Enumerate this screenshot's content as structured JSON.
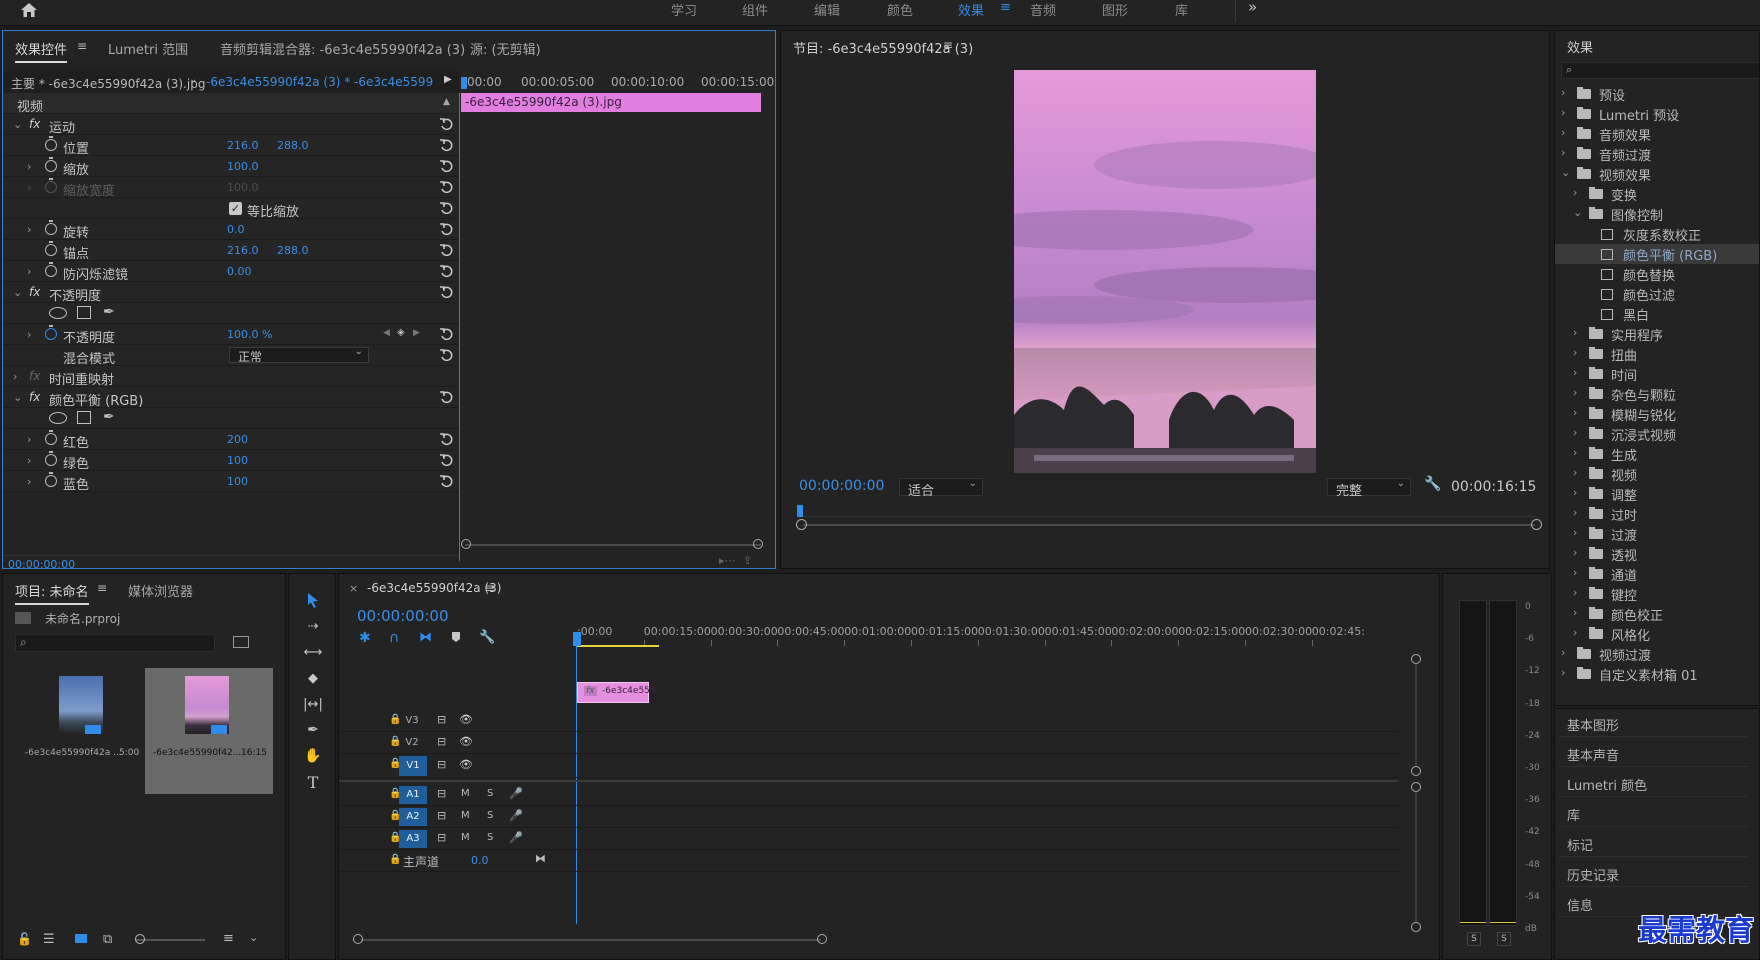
{
  "workspace_tabs": [
    "学习",
    "组件",
    "编辑",
    "颜色",
    "效果",
    "音频",
    "图形",
    "库"
  ],
  "workspace_active": "效果",
  "effect_controls": {
    "tabs": [
      "效果控件",
      "Lumetri 范围",
      "音频剪辑混合器: -6e3c4e55990f42a (3)",
      "源: (无剪辑)"
    ],
    "clip_master": "主要 * -6e3c4e55990f42a (3).jpg",
    "clip_sequence": "-6e3c4e55990f42a (3) * -6e3c4e55990f42a ...",
    "section_video": "视频",
    "mini_timecodes": [
      ":00:00",
      "00:00:05:00",
      "00:00:10:00",
      "00:00:15:00"
    ],
    "mini_clip": "-6e3c4e55990f42a (3).jpg",
    "motion": "运动",
    "position": {
      "label": "位置",
      "x": "216.0",
      "y": "288.0"
    },
    "scale": {
      "label": "缩放",
      "value": "100.0"
    },
    "scale_width": {
      "label": "缩放宽度",
      "value": "100.0"
    },
    "uniform_scale": "等比缩放",
    "rotation": {
      "label": "旋转",
      "value": "0.0"
    },
    "anchor": {
      "label": "锚点",
      "x": "216.0",
      "y": "288.0"
    },
    "antiflicker": {
      "label": "防闪烁滤镜",
      "value": "0.00"
    },
    "opacity_section": "不透明度",
    "opacity": {
      "label": "不透明度",
      "value": "100.0 %"
    },
    "blend_mode": {
      "label": "混合模式",
      "value": "正常"
    },
    "time_remap": "时间重映射",
    "color_balance": "颜色平衡 (RGB)",
    "red": {
      "label": "红色",
      "value": "200"
    },
    "green": {
      "label": "绿色",
      "value": "100"
    },
    "blue": {
      "label": "蓝色",
      "value": "100"
    },
    "timecode": "00:00:00:00"
  },
  "program": {
    "title": "节目: -6e3c4e55990f42a (3)",
    "timecode": "00:00:00:00",
    "fit": "适合",
    "quality": "完整",
    "duration": "00:00:16:15"
  },
  "effects_panel": {
    "title": "效果",
    "items": [
      {
        "label": "预设",
        "level": 0,
        "icon": "star-folder"
      },
      {
        "label": "Lumetri 预设",
        "level": 0,
        "icon": "star-folder"
      },
      {
        "label": "音频效果",
        "level": 0,
        "icon": "folder"
      },
      {
        "label": "音频过渡",
        "level": 0,
        "icon": "folder"
      },
      {
        "label": "视频效果",
        "level": 0,
        "icon": "folder",
        "open": true
      },
      {
        "label": "变换",
        "level": 1,
        "icon": "folder"
      },
      {
        "label": "图像控制",
        "level": 1,
        "icon": "folder",
        "open": true
      },
      {
        "label": "灰度系数校正",
        "level": 2,
        "icon": "effect"
      },
      {
        "label": "颜色平衡 (RGB)",
        "level": 2,
        "icon": "effect",
        "selected": true
      },
      {
        "label": "颜色替换",
        "level": 2,
        "icon": "effect"
      },
      {
        "label": "颜色过滤",
        "level": 2,
        "icon": "effect"
      },
      {
        "label": "黑白",
        "level": 2,
        "icon": "effect"
      },
      {
        "label": "实用程序",
        "level": 1,
        "icon": "folder"
      },
      {
        "label": "扭曲",
        "level": 1,
        "icon": "folder"
      },
      {
        "label": "时间",
        "level": 1,
        "icon": "folder"
      },
      {
        "label": "杂色与颗粒",
        "level": 1,
        "icon": "folder"
      },
      {
        "label": "模糊与锐化",
        "level": 1,
        "icon": "folder"
      },
      {
        "label": "沉浸式视频",
        "level": 1,
        "icon": "folder"
      },
      {
        "label": "生成",
        "level": 1,
        "icon": "folder"
      },
      {
        "label": "视频",
        "level": 1,
        "icon": "folder"
      },
      {
        "label": "调整",
        "level": 1,
        "icon": "folder"
      },
      {
        "label": "过时",
        "level": 1,
        "icon": "folder"
      },
      {
        "label": "过渡",
        "level": 1,
        "icon": "folder"
      },
      {
        "label": "透视",
        "level": 1,
        "icon": "folder"
      },
      {
        "label": "通道",
        "level": 1,
        "icon": "folder"
      },
      {
        "label": "键控",
        "level": 1,
        "icon": "folder"
      },
      {
        "label": "颜色校正",
        "level": 1,
        "icon": "folder"
      },
      {
        "label": "风格化",
        "level": 1,
        "icon": "folder"
      },
      {
        "label": "视频过渡",
        "level": 0,
        "icon": "folder"
      },
      {
        "label": "自定义素材箱 01",
        "level": 0,
        "icon": "folder"
      }
    ],
    "side_panels": [
      "基本图形",
      "基本声音",
      "Lumetri 颜色",
      "库",
      "标记",
      "历史记录",
      "信息"
    ]
  },
  "project": {
    "tabs": [
      "项目: 未命名",
      "媒体浏览器"
    ],
    "file": "未命名.prproj",
    "items": [
      {
        "name": "-6e3c4e55990f42a ...",
        "duration": "5:00"
      },
      {
        "name": "-6e3c4e55990f42...",
        "duration": "16:15"
      }
    ]
  },
  "timeline": {
    "title": "-6e3c4e55990f42a (3)",
    "timecode": "00:00:00:00",
    "ruler": [
      ":00:00",
      "00:00:15:00",
      "00:00:30:00",
      "00:00:45:00",
      "00:01:00:00",
      "00:01:15:00",
      "00:01:30:00",
      "00:01:45:00",
      "00:02:00:00",
      "00:02:15:00",
      "00:02:30:00",
      "00:02:45:"
    ],
    "video_tracks": [
      "V3",
      "V2",
      "V1"
    ],
    "audio_tracks": [
      "A1",
      "A2",
      "A3"
    ],
    "master": "主声道",
    "master_value": "0.0",
    "clip": "-6e3c4e559",
    "ms_labels": [
      "M",
      "S"
    ]
  },
  "meter": {
    "scale": [
      "0",
      "-6",
      "-12",
      "-18",
      "-24",
      "-30",
      "-36",
      "-42",
      "-48",
      "-54",
      "dB"
    ],
    "solo": [
      "S",
      "S"
    ]
  },
  "watermark": "最需教育",
  "colors": {
    "accent": "#2f8ce8",
    "clip_pink": "#e07fe0",
    "panel": "#232323",
    "track_on": "#1f5e9a"
  }
}
